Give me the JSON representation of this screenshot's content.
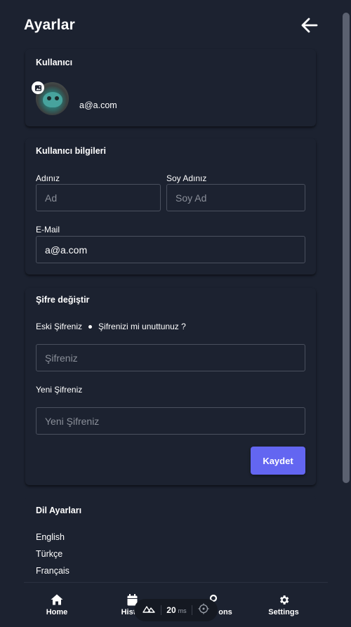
{
  "header": {
    "title": "Ayarlar"
  },
  "user": {
    "section_title": "Kullanıcı",
    "email": "a@a.com"
  },
  "info": {
    "section_title": "Kullanıcı bilgileri",
    "first_name_label": "Adınız",
    "first_name_placeholder": "Ad",
    "last_name_label": "Soy Adınız",
    "last_name_placeholder": "Soy Ad",
    "email_label": "E-Mail",
    "email_value": "a@a.com"
  },
  "password": {
    "section_title": "Şifre değiştir",
    "old_label": "Eski Şifreniz",
    "forgot_link": "Şifrenizi mi unuttunuz ?",
    "old_placeholder": "Şifreniz",
    "new_label": "Yeni Şifreniz",
    "new_placeholder": "Yeni Şifreniz",
    "save_label": "Kaydet"
  },
  "language": {
    "section_title": "Dil Ayarları",
    "options": [
      "English",
      "Türkçe",
      "Français"
    ]
  },
  "nav": {
    "home": "Home",
    "history": "Hist",
    "options": "ons",
    "settings": "Settings"
  },
  "devtools": {
    "value": "20",
    "unit": "ms"
  },
  "colors": {
    "background": "#1c2230",
    "accent": "#6366f1",
    "border": "#4a505e"
  }
}
